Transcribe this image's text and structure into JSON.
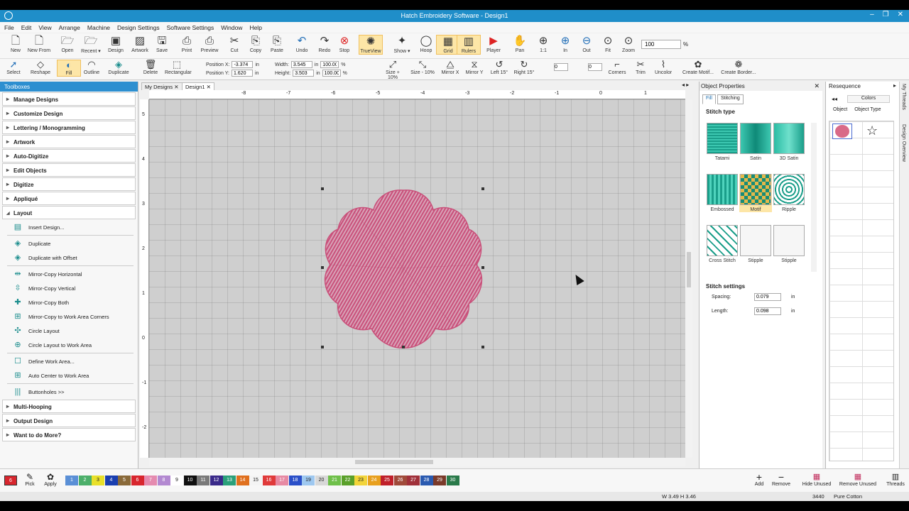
{
  "window": {
    "title": "Hatch Embroidery Software - Design1",
    "controls": [
      "–",
      "❐",
      "✕"
    ]
  },
  "menu": [
    "File",
    "Edit",
    "View",
    "Arrange",
    "Machine",
    "Design Settings",
    "Software Settings",
    "Window",
    "Help"
  ],
  "toolbar1": [
    {
      "label": "New",
      "icon": "new-file-icon"
    },
    {
      "label": "New From",
      "icon": "new-from-icon"
    },
    {
      "label": "Open",
      "icon": "open-folder-icon"
    },
    {
      "label": "Recent ▾",
      "icon": "recent-icon"
    },
    {
      "label": "Design",
      "icon": "design-icon"
    },
    {
      "label": "Artwork",
      "icon": "artwork-icon"
    },
    {
      "label": "Save",
      "icon": "save-icon"
    },
    {
      "label": "Print",
      "icon": "print-icon"
    },
    {
      "label": "Preview",
      "icon": "preview-icon"
    },
    {
      "label": "Cut",
      "icon": "cut-icon"
    },
    {
      "label": "Copy",
      "icon": "copy-icon"
    },
    {
      "label": "Paste",
      "icon": "paste-icon"
    },
    {
      "label": "Undo",
      "icon": "undo-icon"
    },
    {
      "label": "Redo",
      "icon": "redo-icon"
    },
    {
      "label": "Stop",
      "icon": "stop-icon"
    },
    {
      "label": "TrueView",
      "icon": "trueview-icon"
    },
    {
      "label": "Show ▾",
      "icon": "show-icon"
    },
    {
      "label": "Hoop",
      "icon": "hoop-icon"
    },
    {
      "label": "Grid",
      "icon": "grid-icon"
    },
    {
      "label": "Rulers",
      "icon": "rulers-icon"
    },
    {
      "label": "Player",
      "icon": "player-icon"
    },
    {
      "label": "Pan",
      "icon": "pan-icon"
    },
    {
      "label": "1:1",
      "icon": "zoom-1to1-icon"
    },
    {
      "label": "In",
      "icon": "zoom-in-icon"
    },
    {
      "label": "Out",
      "icon": "zoom-out-icon"
    },
    {
      "label": "Fit",
      "icon": "zoom-fit-icon"
    },
    {
      "label": "Zoom",
      "icon": "zoom-icon"
    }
  ],
  "zoom": {
    "value": "100",
    "unit": "%"
  },
  "toolbar2": {
    "left": [
      {
        "label": "Select",
        "icon": "select-arrow-icon"
      },
      {
        "label": "Reshape",
        "icon": "reshape-icon"
      },
      {
        "label": "Fill",
        "icon": "fill-icon"
      },
      {
        "label": "Outline",
        "icon": "outline-icon"
      },
      {
        "label": "Duplicate",
        "icon": "duplicate-icon"
      },
      {
        "label": "Delete",
        "icon": "delete-icon"
      },
      {
        "label": "Rectangular",
        "icon": "rectangular-icon"
      }
    ],
    "position": {
      "x_label": "Position X:",
      "x": "-3.374",
      "y_label": "Position Y:",
      "y": "1.620",
      "unit": "in"
    },
    "size": {
      "w_label": "Width:",
      "w": "3.545",
      "h_label": "Height:",
      "h": "3.503",
      "unit": "in",
      "wp": "100.00",
      "hp": "100.00",
      "pct": "%"
    },
    "right": [
      {
        "label": "Size + 10%",
        "icon": "size-plus-icon"
      },
      {
        "label": "Size - 10%",
        "icon": "size-minus-icon"
      },
      {
        "label": "Mirror X",
        "icon": "mirror-x-icon"
      },
      {
        "label": "Mirror Y",
        "icon": "mirror-y-icon"
      },
      {
        "label": "Left 15°",
        "icon": "rotate-left-icon"
      },
      {
        "label": "Right 15°",
        "icon": "rotate-right-icon"
      },
      {
        "label": "Corners",
        "icon": "corners-icon"
      },
      {
        "label": "Trim",
        "icon": "trim-icon"
      },
      {
        "label": "Uncolor",
        "icon": "uncolor-icon"
      },
      {
        "label": "Create Motif...",
        "icon": "create-motif-icon"
      },
      {
        "label": "Create Border...",
        "icon": "create-border-icon"
      }
    ],
    "rotate_val": "0",
    "skew_val": "0"
  },
  "toolboxes": {
    "title": "Toolboxes",
    "sections_top": [
      "Manage Designs",
      "Customize Design",
      "Lettering / Monogramming",
      "Artwork",
      "Auto-Digitize",
      "Edit Objects",
      "Digitize",
      "Appliqué"
    ],
    "open_section": "Layout",
    "layout_items": [
      {
        "label": "Insert Design...",
        "icon": "insert-design-icon"
      },
      {
        "label": "Duplicate",
        "icon": "duplicate-icon"
      },
      {
        "label": "Duplicate with Offset",
        "icon": "duplicate-offset-icon"
      },
      {
        "label": "Mirror-Copy Horizontal",
        "icon": "mirror-copy-h-icon"
      },
      {
        "label": "Mirror-Copy Vertical",
        "icon": "mirror-copy-v-icon"
      },
      {
        "label": "Mirror-Copy Both",
        "icon": "mirror-copy-both-icon"
      },
      {
        "label": "Mirror-Copy to Work Area Corners",
        "icon": "mirror-copy-corners-icon"
      },
      {
        "label": "Circle Layout",
        "icon": "circle-layout-icon"
      },
      {
        "label": "Circle Layout to Work Area",
        "icon": "circle-layout-work-icon"
      },
      {
        "label": "Define Work Area...",
        "icon": "define-work-area-icon"
      },
      {
        "label": "Auto Center to Work Area",
        "icon": "auto-center-icon"
      },
      {
        "label": "Buttonholes >>",
        "icon": "buttonholes-icon"
      }
    ],
    "sections_bottom": [
      "Multi-Hooping",
      "Output Design",
      "Want to do More?"
    ]
  },
  "doc_tabs": [
    "My Designs",
    "Design1"
  ],
  "ruler_h_labels": [
    "-8",
    "-7",
    "-6",
    "-5",
    "-4",
    "-3",
    "-2",
    "-1",
    "0",
    "1"
  ],
  "ruler_v_labels": [
    "5",
    "4",
    "3",
    "2",
    "1",
    "0",
    "-1",
    "-2"
  ],
  "object_properties": {
    "title": "Object Properties",
    "tabs": [
      "Fill",
      "Stitching"
    ],
    "stitch_type_title": "Stitch type",
    "types": [
      {
        "label": "Tatami",
        "cls": "tatami"
      },
      {
        "label": "Satin",
        "cls": "satin"
      },
      {
        "label": "3D Satin",
        "cls": "satin3"
      },
      {
        "label": "Embossed",
        "cls": "emb"
      },
      {
        "label": "Motif",
        "cls": "motif",
        "selected": true
      },
      {
        "label": "Ripple",
        "cls": "ripple"
      },
      {
        "label": "Cross Stitch",
        "cls": "cross"
      },
      {
        "label": "Stipple",
        "cls": "stip"
      },
      {
        "label": "Stipple",
        "cls": "stip"
      }
    ],
    "settings_title": "Stitch settings",
    "spacing_label": "Spacing:",
    "spacing": "0.079",
    "length_label": "Length:",
    "length": "0.098",
    "unit": "in"
  },
  "resequence": {
    "title": "Resequence",
    "colors_label": "Colors",
    "cols": [
      "Object",
      "Object Type"
    ]
  },
  "side_tabs": [
    "My Threads",
    "Design Overview"
  ],
  "palette": [
    {
      "n": "6",
      "c": "#d8262e"
    },
    {
      "n": "1",
      "c": "#5a8fd6"
    },
    {
      "n": "2",
      "c": "#4caf6a"
    },
    {
      "n": "3",
      "c": "#e8e02a"
    },
    {
      "n": "4",
      "c": "#1a3fb0"
    },
    {
      "n": "5",
      "c": "#8a6a3a"
    },
    {
      "n": "6",
      "c": "#d8262e"
    },
    {
      "n": "7",
      "c": "#e58bb0"
    },
    {
      "n": "8",
      "c": "#b389d1"
    },
    {
      "n": "9",
      "c": "#ffffff"
    },
    {
      "n": "10",
      "c": "#111111"
    },
    {
      "n": "11",
      "c": "#7a7a7a"
    },
    {
      "n": "12",
      "c": "#3a2a8a"
    },
    {
      "n": "13",
      "c": "#2aa07a"
    },
    {
      "n": "14",
      "c": "#e0701e"
    },
    {
      "n": "15",
      "c": "#f4f4f4"
    },
    {
      "n": "16",
      "c": "#e03a3a"
    },
    {
      "n": "17",
      "c": "#e78aa4"
    },
    {
      "n": "18",
      "c": "#2a4fc8"
    },
    {
      "n": "19",
      "c": "#9ec8f0"
    },
    {
      "n": "20",
      "c": "#d8d8d8"
    },
    {
      "n": "21",
      "c": "#6fc04a"
    },
    {
      "n": "22",
      "c": "#5aa02a"
    },
    {
      "n": "23",
      "c": "#f2d43a"
    },
    {
      "n": "24",
      "c": "#e8a01e"
    },
    {
      "n": "25",
      "c": "#c0202a"
    },
    {
      "n": "26",
      "c": "#a04a3a"
    },
    {
      "n": "27",
      "c": "#a0303a"
    },
    {
      "n": "28",
      "c": "#2a5ab0"
    },
    {
      "n": "29",
      "c": "#7a3a2a"
    },
    {
      "n": "30",
      "c": "#2a7a4a"
    }
  ],
  "bottom_tools": {
    "pick": "Pick",
    "apply": "Apply",
    "add": "Add",
    "remove": "Remove",
    "hide_unused": "Hide Unused",
    "remove_unused": "Remove Unused",
    "threads": "Threads"
  },
  "status": {
    "dims": "W 3.49 H 3.46",
    "stitches": "3440",
    "thread": "Pure Cotton"
  },
  "colors": {
    "accent": "#1f8ec9",
    "selected": "#fde6a7",
    "design": "#c9507a"
  }
}
